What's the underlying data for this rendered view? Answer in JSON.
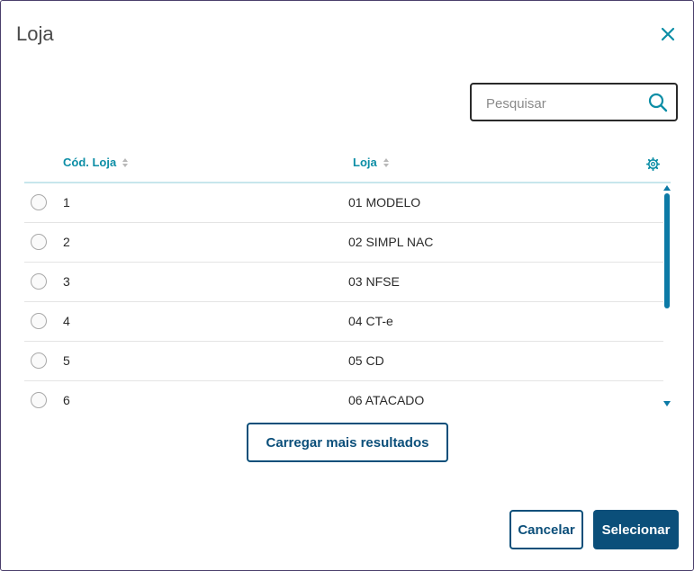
{
  "dialog": {
    "title": "Loja",
    "close_icon": "close-icon"
  },
  "search": {
    "placeholder": "Pesquisar",
    "value": "",
    "icon": "search-icon"
  },
  "table": {
    "columns": [
      {
        "label": "Cód. Loja"
      },
      {
        "label": "Loja"
      }
    ],
    "settings_icon": "gear-icon",
    "rows": [
      {
        "cod": "1",
        "loja": "01 MODELO"
      },
      {
        "cod": "2",
        "loja": "02 SIMPL NAC"
      },
      {
        "cod": "3",
        "loja": "03 NFSE"
      },
      {
        "cod": "4",
        "loja": "04 CT-e"
      },
      {
        "cod": "5",
        "loja": "05 CD"
      },
      {
        "cod": "6",
        "loja": "06 ATACADO"
      }
    ]
  },
  "actions": {
    "load_more": "Carregar mais resultados",
    "cancel": "Cancelar",
    "select": "Selecionar"
  },
  "colors": {
    "accent": "#0c8ea6",
    "primary": "#0b4f7a"
  }
}
